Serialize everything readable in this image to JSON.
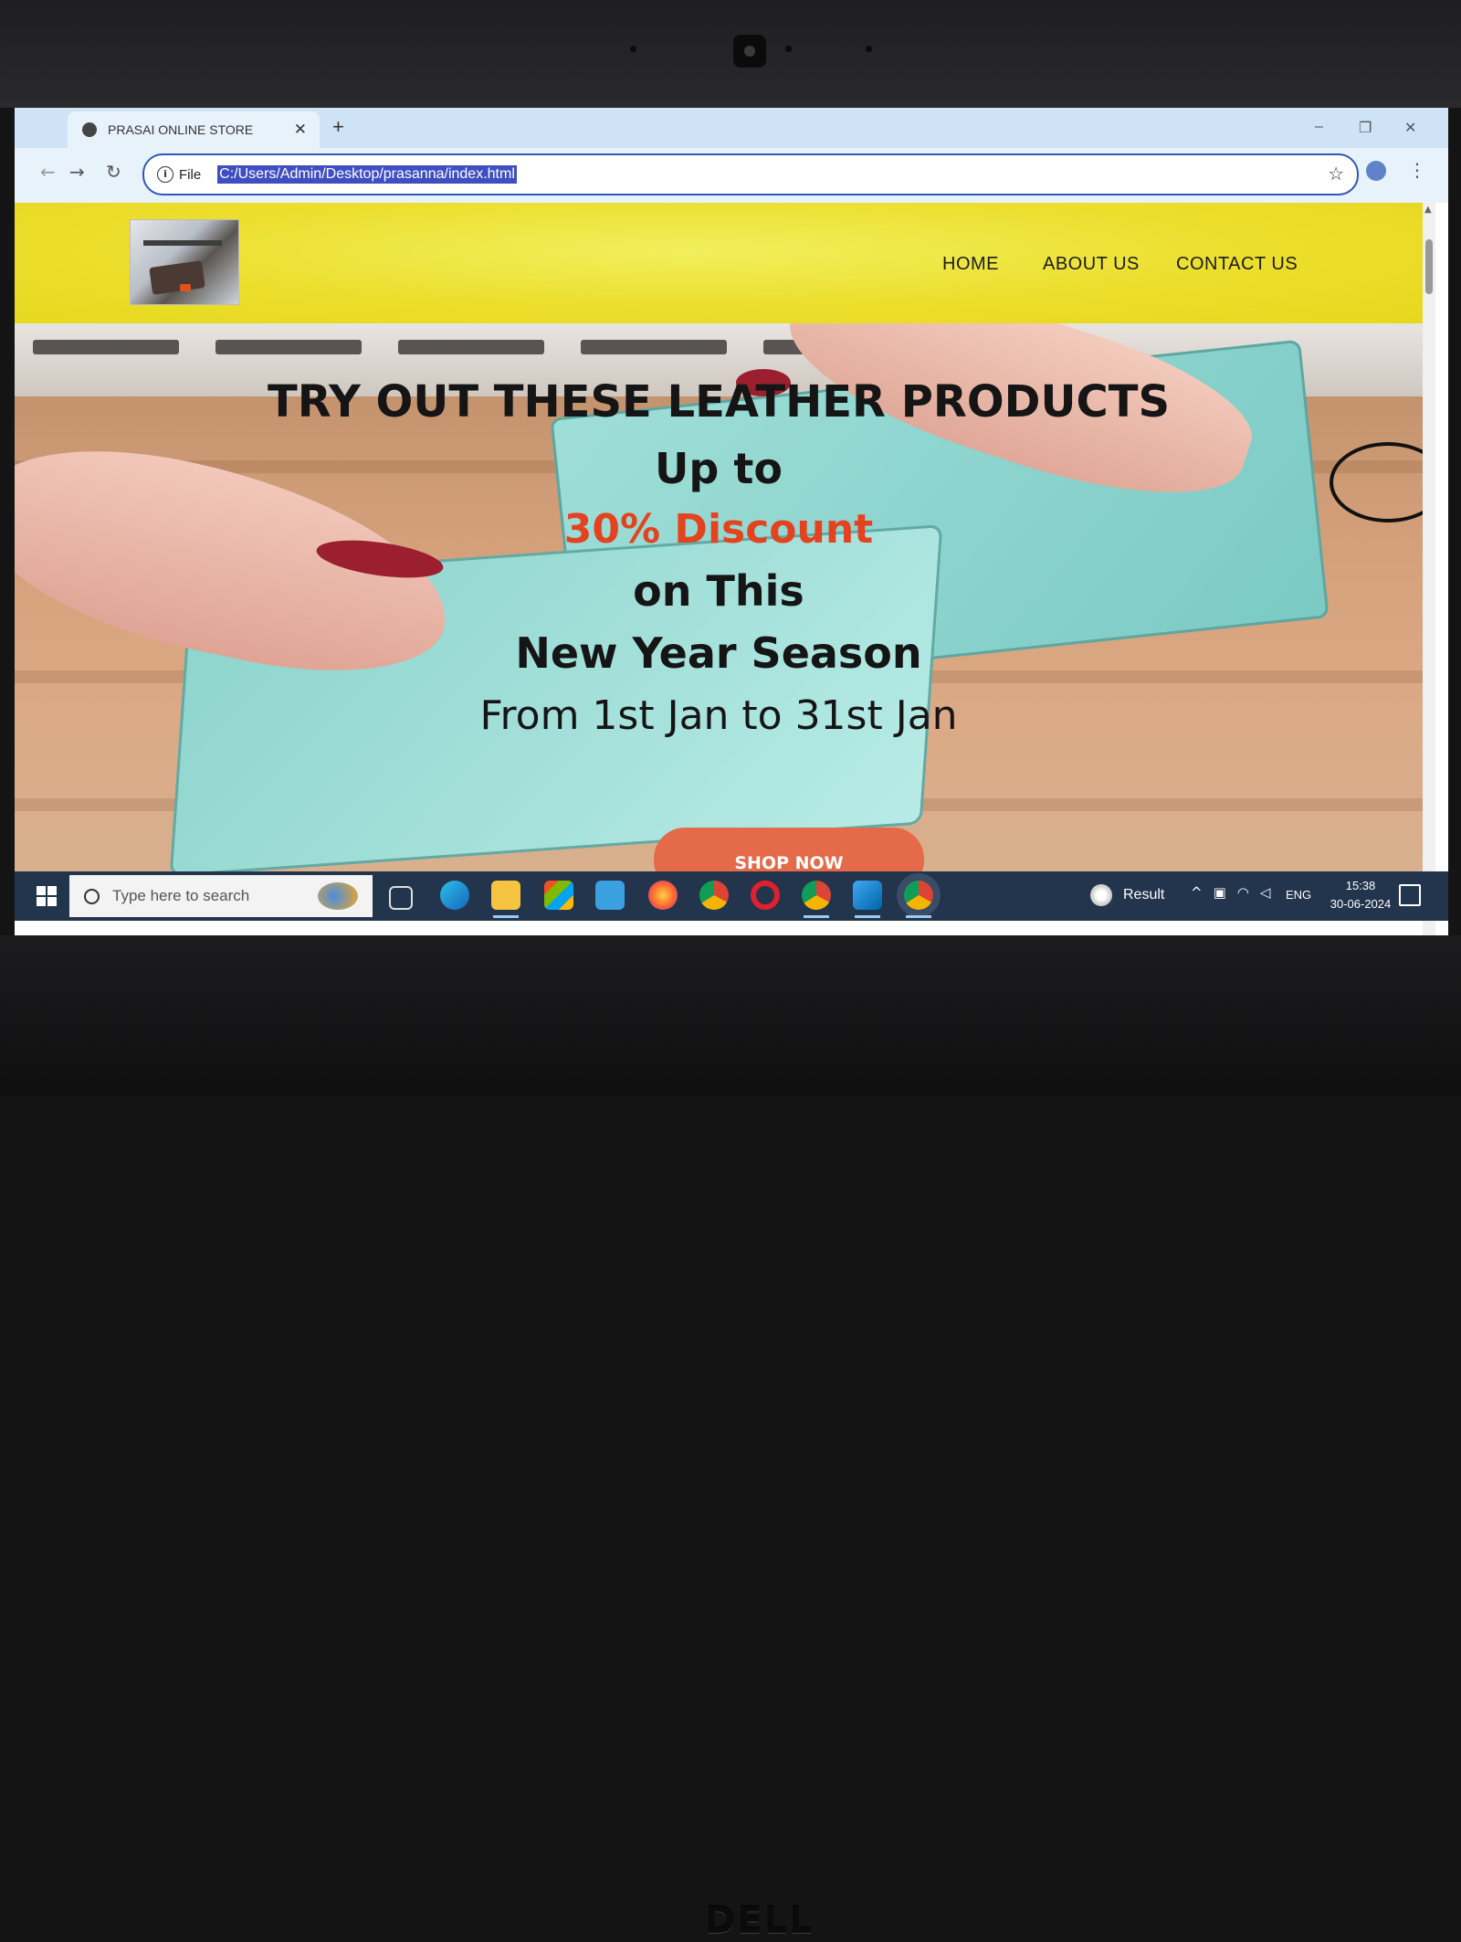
{
  "browser": {
    "tab_title": "PRASAI ONLINE STORE",
    "tab_close": "✕",
    "new_tab": "+",
    "window_controls": {
      "minimize": "–",
      "restore": "❐",
      "close": "✕"
    },
    "back": "←",
    "forward": "→",
    "reload": "↻",
    "address_chip": "File",
    "url": "C:/Users/Admin/Desktop/prasanna/index.html",
    "bookmark_icon": "star-icon",
    "menu_icon": "⋮"
  },
  "site": {
    "nav": [
      "HOME",
      "ABOUT US",
      "CONTACT US"
    ],
    "hero": {
      "title": "TRY OUT THESE LEATHER PRODUCTS",
      "line2": "Up to",
      "discount": "30% Discount",
      "line4": "on This",
      "line5": "New Year Season",
      "dates": "From 1st Jan to 31st Jan",
      "button": "SHOP NOW"
    },
    "colors": {
      "header_bg": "#ecde2c",
      "discount_text": "#e4431f",
      "button_bg": "#e46a4a"
    }
  },
  "taskbar": {
    "search_placeholder": "Type here to search",
    "apps": [
      "task-view",
      "edge",
      "file-explorer",
      "microsoft-store",
      "mail",
      "firefox",
      "chrome",
      "opera",
      "chrome-profile",
      "vscode",
      "chrome-active"
    ],
    "result_label": "Result",
    "language": "ENG",
    "time": "15:38",
    "date": "30-06-2024"
  },
  "device": {
    "brand": "DELL"
  }
}
